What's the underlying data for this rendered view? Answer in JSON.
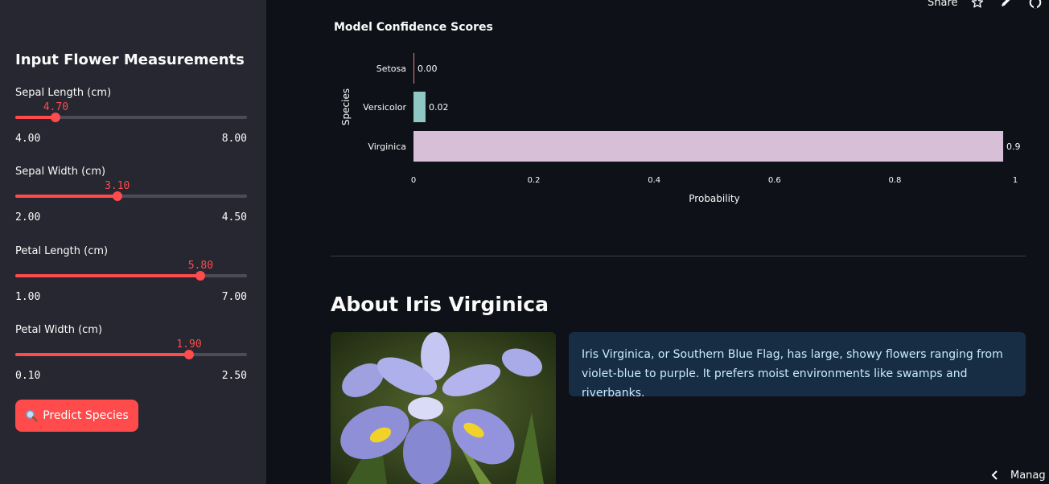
{
  "header": {
    "share_label": "Share"
  },
  "sidebar": {
    "title": "Input Flower Measurements",
    "sliders": [
      {
        "label": "Sepal Length (cm)",
        "value": "4.70",
        "min": "4.00",
        "max": "8.00",
        "fraction": 0.175
      },
      {
        "label": "Sepal Width (cm)",
        "value": "3.10",
        "min": "2.00",
        "max": "4.50",
        "fraction": 0.44
      },
      {
        "label": "Petal Length (cm)",
        "value": "5.80",
        "min": "1.00",
        "max": "7.00",
        "fraction": 0.8
      },
      {
        "label": "Petal Width (cm)",
        "value": "1.90",
        "min": "0.10",
        "max": "2.50",
        "fraction": 0.75
      }
    ],
    "predict_button": {
      "label": "Predict Species",
      "icon": "magnifier-icon"
    }
  },
  "chart_data": {
    "type": "bar",
    "orientation": "horizontal",
    "title": "Model Confidence Scores",
    "xlabel": "Probability",
    "ylabel": "Species",
    "categories": [
      "Setosa",
      "Versicolor",
      "Virginica"
    ],
    "values": [
      0.0,
      0.02,
      0.98
    ],
    "value_labels": [
      "0.00",
      "0.02",
      "0.9"
    ],
    "colors": [
      "#e3807a",
      "#8ec7c4",
      "#d8bfd8"
    ],
    "xlim": [
      0,
      1
    ],
    "xticks": [
      "0",
      "0.2",
      "0.4",
      "0.6",
      "0.8",
      "1"
    ],
    "grid": false
  },
  "about": {
    "title": "About Iris Virginica",
    "description": "Iris Virginica, or Southern Blue Flag, has large, showy flowers ranging from violet-blue to purple. It prefers moist environments like swamps and riverbanks."
  },
  "footer": {
    "manage_label": "Manag"
  },
  "colors": {
    "accent": "#ff4b4b",
    "sidebar_bg": "#262730",
    "main_bg": "#0e1117",
    "info_bg": "#172d43",
    "info_text": "#c7ebff"
  }
}
